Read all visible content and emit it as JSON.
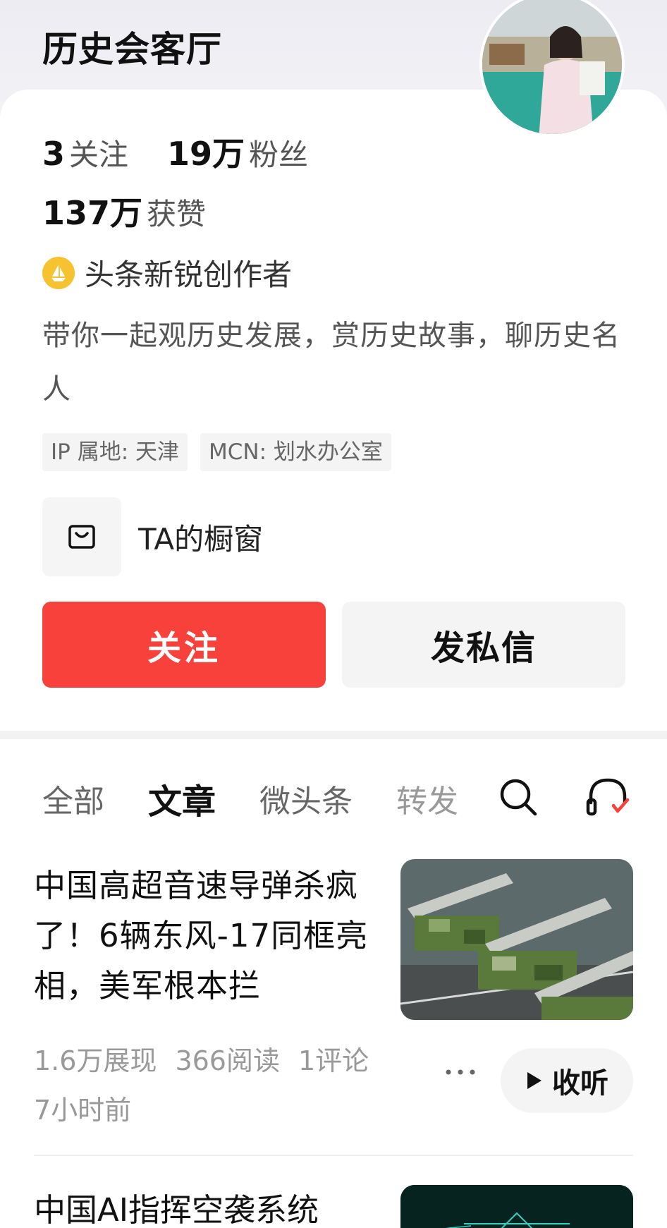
{
  "header": {
    "username": "历史会客厅"
  },
  "stats": {
    "following_count": "3",
    "following_label": "关注",
    "fans_count": "19万",
    "fans_label": "粉丝",
    "likes_count": "137万",
    "likes_label": "获赞"
  },
  "creator_badge": {
    "text": "头条新锐创作者",
    "icon": "sailboat-badge-icon",
    "color": "#f6c230"
  },
  "bio": "带你一起观历史发展，赏历史故事，聊历史名人",
  "tags": [
    "IP 属地: 天津",
    "MCN: 划水办公室"
  ],
  "shop": {
    "label": "TA的橱窗",
    "icon": "shopping-bag-icon"
  },
  "buttons": {
    "follow": "关注",
    "message": "发私信",
    "follow_color": "#f7413a"
  },
  "tabs": [
    {
      "label": "全部"
    },
    {
      "label": "文章",
      "active": true
    },
    {
      "label": "微头条"
    },
    {
      "label": "转发"
    }
  ],
  "articles": [
    {
      "title": "中国高超音速导弹杀疯了！6辆东风-17同框亮相，美军根本拦",
      "meta": {
        "impressions": "1.6万展现",
        "reads": "366阅读",
        "comments": "1评论"
      },
      "time": "7小时前",
      "listen_label": "收听"
    },
    {
      "title": "中国AI指挥空袭系统"
    }
  ]
}
